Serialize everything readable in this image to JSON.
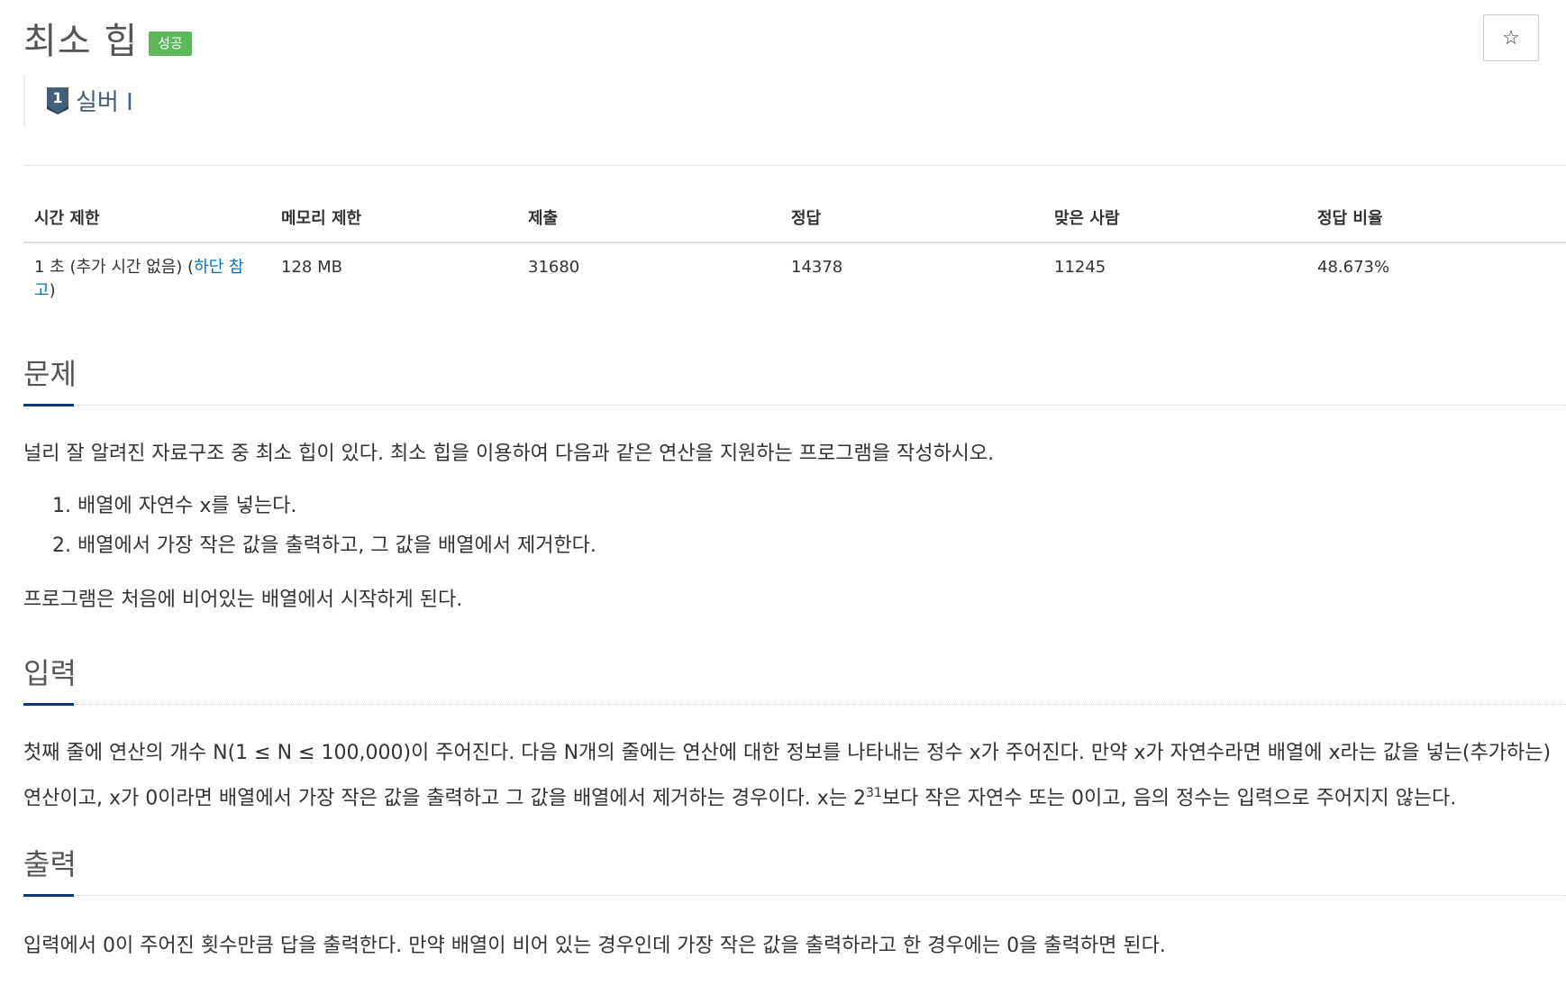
{
  "problem": {
    "title": "최소 힙",
    "status_badge": "성공",
    "star_symbol": "☆",
    "tier": {
      "number": "1",
      "label": "실버 I",
      "color": "#435f7a"
    }
  },
  "info": {
    "headers": [
      "시간 제한",
      "메모리 제한",
      "제출",
      "정답",
      "맞은 사람",
      "정답 비율"
    ],
    "time_limit_prefix": "1 초 (추가 시간 없음) (",
    "time_limit_link": "하단 참고",
    "time_limit_suffix": ")",
    "memory_limit": "128 MB",
    "submissions": "31680",
    "accepted": "14378",
    "solvers": "11245",
    "ratio": "48.673%"
  },
  "description": {
    "heading": "문제",
    "intro": "널리 잘 알려진 자료구조 중 최소 힙이 있다. 최소 힙을 이용하여 다음과 같은 연산을 지원하는 프로그램을 작성하시오.",
    "items": [
      "1. 배열에 자연수 x를 넣는다.",
      "2. 배열에서 가장 작은 값을 출력하고, 그 값을 배열에서 제거한다."
    ],
    "outro": "프로그램은 처음에 비어있는 배열에서 시작하게 된다."
  },
  "input": {
    "heading": "입력",
    "line1": "첫째 줄에 연산의 개수 N(1 ≤ N ≤ 100,000)이 주어진다. 다음 N개의 줄에는 연산에 대한 정보를 나타내는 정수 x가 주어진다. 만약 x가 자연수라면 배열에 x라는 값을 넣는(추가하는)",
    "line2_before": "연산이고, x가 0이라면 배열에서 가장 작은 값을 출력하고 그 값을 배열에서 제거하는 경우이다. x는 2",
    "line2_sup": "31",
    "line2_after": "보다 작은 자연수 또는 0이고, 음의 정수는 입력으로 주어지지 않는다."
  },
  "output": {
    "heading": "출력",
    "text": "입력에서 0이 주어진 횟수만큼 답을 출력한다. 만약 배열이 비어 있는 경우인데 가장 작은 값을 출력하라고 한 경우에는 0을 출력하면 된다."
  },
  "colors": {
    "success": "#5cb85c",
    "link": "#0076c0",
    "section_underline": "#0d3a73"
  }
}
